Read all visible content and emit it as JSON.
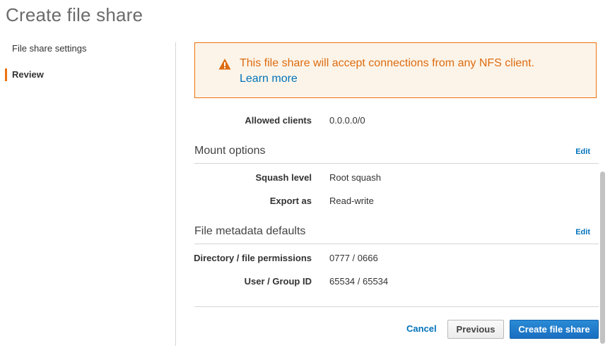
{
  "page": {
    "title": "Create file share"
  },
  "nav": {
    "items": [
      {
        "label": "File share settings"
      },
      {
        "label": "Review"
      }
    ]
  },
  "alert": {
    "message": "This file share will accept connections from any NFS client. ",
    "link": "Learn more",
    "icon": "warning-icon",
    "color": "#dd6b10"
  },
  "allowed_clients": {
    "label": "Allowed clients",
    "value": "0.0.0.0/0"
  },
  "mount_options": {
    "title": "Mount options",
    "edit": "Edit",
    "squash_level": {
      "label": "Squash level",
      "value": "Root squash"
    },
    "export_as": {
      "label": "Export as",
      "value": "Read-write"
    }
  },
  "file_metadata": {
    "title": "File metadata defaults",
    "edit": "Edit",
    "permissions": {
      "label": "Directory / file permissions",
      "value": "0777 / 0666"
    },
    "user_group": {
      "label": "User / Group ID",
      "value": "65534 / 65534"
    }
  },
  "actions": {
    "cancel": "Cancel",
    "previous": "Previous",
    "create": "Create file share"
  },
  "colors": {
    "accent": "#ec7211",
    "link": "#0073bb",
    "primary_button": "#1a6ec0"
  }
}
